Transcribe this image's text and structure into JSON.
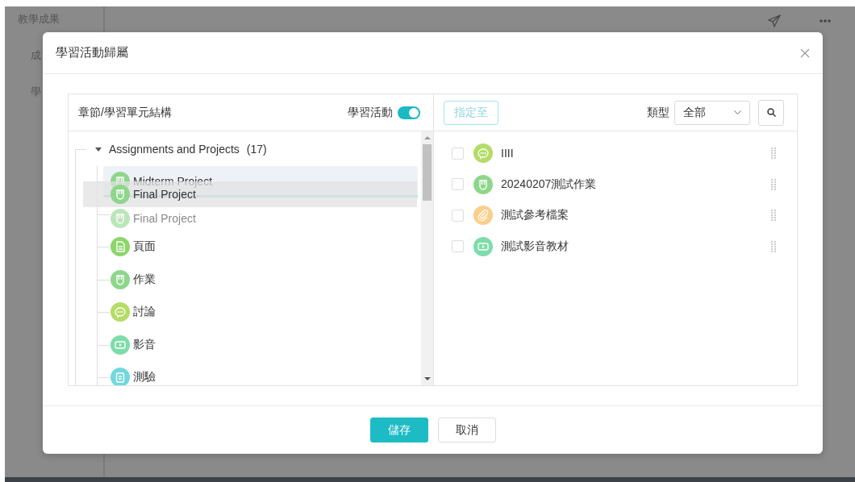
{
  "background": {
    "sidebar": [
      {
        "label": "教學成果"
      },
      {
        "label": "成"
      },
      {
        "label": "學"
      }
    ]
  },
  "dialog": {
    "title": "學習活動歸屬",
    "tree_panel": {
      "heading": "章節/學習單元結構",
      "toggle": {
        "label": "學習活動",
        "on": true
      },
      "root": {
        "label": "Assignments and Projects",
        "count": "(17)",
        "expanded": true,
        "children": [
          {
            "label": "Midterm Project",
            "kind": "assignment",
            "drop_target": true,
            "dragging": false
          },
          {
            "label": "Final Project",
            "kind": "assignment",
            "drop_target": false,
            "dragging": true
          },
          {
            "label": "頁面",
            "kind": "page",
            "drop_target": false,
            "dragging": false
          },
          {
            "label": "作業",
            "kind": "assignment",
            "drop_target": false,
            "dragging": false
          },
          {
            "label": "討論",
            "kind": "discussion",
            "drop_target": false,
            "dragging": false
          },
          {
            "label": "影音",
            "kind": "video",
            "drop_target": false,
            "dragging": false
          },
          {
            "label": "測驗",
            "kind": "quiz",
            "drop_target": false,
            "dragging": false
          }
        ]
      },
      "drag_ghost": {
        "label": "Final Project",
        "kind": "assignment"
      }
    },
    "list_panel": {
      "assign_button": {
        "label": "指定至",
        "disabled": true
      },
      "type_label": "類型",
      "type_select": "全部",
      "items": [
        {
          "label": "IIII",
          "kind": "discussion",
          "checked": false
        },
        {
          "label": "20240207測試作業",
          "kind": "assignment",
          "checked": false
        },
        {
          "label": "測試參考檔案",
          "kind": "file",
          "checked": false
        },
        {
          "label": "測試影音教材",
          "kind": "video",
          "checked": false
        }
      ]
    },
    "buttons": [
      {
        "label": "儲存",
        "kind": "primary"
      },
      {
        "label": "取消",
        "kind": "default"
      }
    ]
  }
}
